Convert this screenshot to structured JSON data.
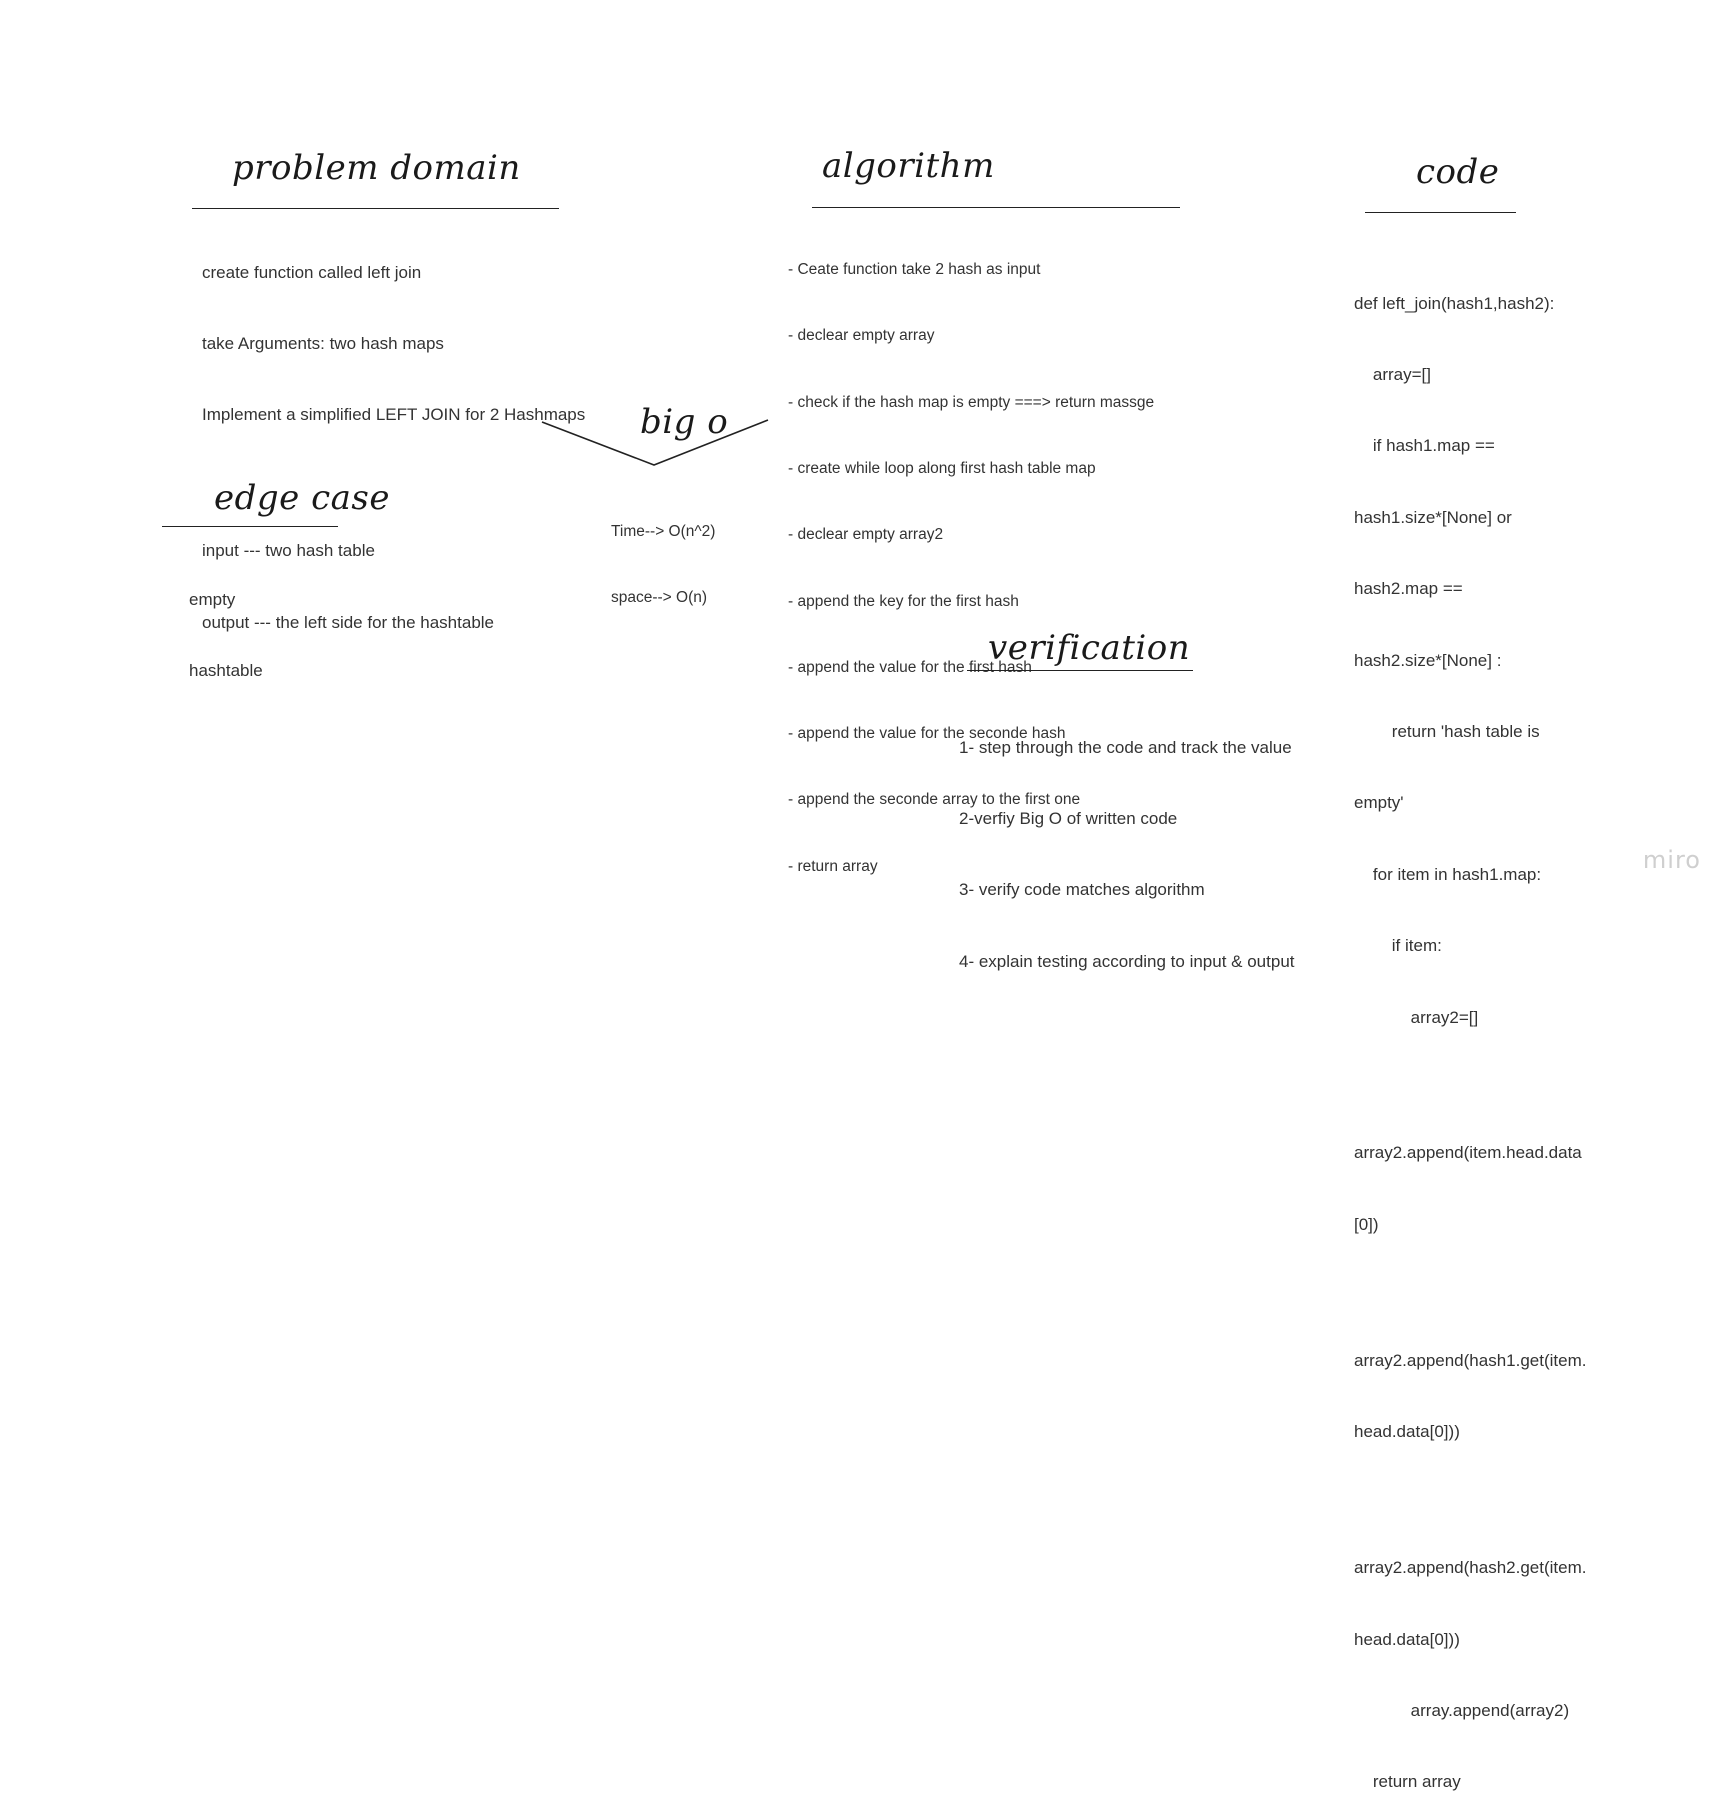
{
  "sections": {
    "problem_domain": {
      "title": "problem domain",
      "lines": [
        "create function called left join",
        "take Arguments: two hash maps",
        "Implement a simplified LEFT JOIN for 2 Hashmaps",
        "",
        "input --- two hash table",
        "output --- the left side for the hashtable"
      ]
    },
    "algorithm": {
      "title": "algorithm",
      "lines": [
        "- Ceate function take 2 hash as input",
        "- declear empty array",
        "- check if the hash map is empty ===> return massge",
        "- create while loop along first hash table map",
        "- declear empty array2",
        "- append the key for the first hash",
        "- append the value for the first hash",
        "- append the value for the seconde hash",
        "- append the seconde array to the first one",
        "- return array"
      ]
    },
    "code": {
      "title": "code",
      "lines": [
        "def left_join(hash1,hash2):",
        "    array=[]",
        "    if hash1.map ==",
        "hash1.size*[None] or",
        "hash2.map ==",
        "hash2.size*[None] :",
        "        return 'hash table is",
        "empty'",
        "    for item in hash1.map:",
        "        if item:",
        "            array2=[]",
        "",
        "array2.append(item.head.data",
        "[0])",
        "",
        "array2.append(hash1.get(item.",
        "head.data[0]))",
        "",
        "array2.append(hash2.get(item.",
        "head.data[0]))",
        "            array.append(array2)",
        "    return array"
      ]
    },
    "big_o": {
      "title": "big o",
      "lines": [
        "Time--> O(n^2)",
        "space--> O(n)"
      ]
    },
    "edge_case": {
      "title": "edge case",
      "lines": [
        "empty",
        "hashtable"
      ]
    },
    "verification": {
      "title": "verification",
      "lines": [
        "1- step through the code and track the value",
        "2-verfiy Big O of written code",
        "3- verify code matches algorithm",
        "4- explain testing according to input & output"
      ]
    }
  },
  "watermark": "miro",
  "colors": {
    "background": "#ffffff",
    "text": "#333333",
    "heading": "#1a1a1a",
    "watermark": "#cfcfcf"
  }
}
